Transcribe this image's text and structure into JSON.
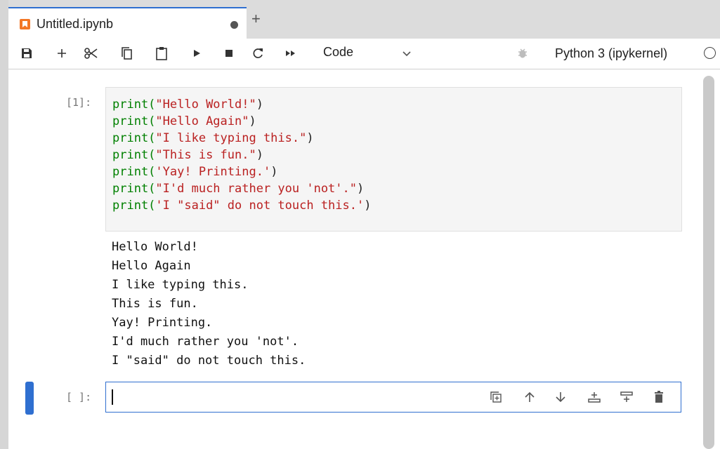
{
  "tab": {
    "title": "Untitled.ipynb",
    "new_tab": "+"
  },
  "toolbar": {
    "cell_type": "Code",
    "kernel": "Python 3 (ipykernel)"
  },
  "cells": [
    {
      "prompt": "[1]:",
      "code": [
        [
          "print(",
          "\"Hello World!\"",
          ")"
        ],
        [
          "print(",
          "\"Hello Again\"",
          ")"
        ],
        [
          "print(",
          "\"I like typing this.\"",
          ")"
        ],
        [
          "print(",
          "\"This is fun.\"",
          ")"
        ],
        [
          "print(",
          "'Yay! Printing.'",
          ")"
        ],
        [
          "print(",
          "\"I'd much rather you 'not'.\"",
          ")"
        ],
        [
          "print(",
          "'I \"said\" do not touch this.'",
          ")"
        ]
      ],
      "output": [
        "Hello World!",
        "Hello Again",
        "I like typing this.",
        "This is fun.",
        "Yay! Printing.",
        "I'd much rather you 'not'.",
        "I \"said\" do not touch this."
      ]
    },
    {
      "prompt": "[ ]:",
      "code": [],
      "output": []
    }
  ],
  "colors": {
    "accent": "#2f6fd0",
    "function": "#008000",
    "string": "#ba2121"
  }
}
